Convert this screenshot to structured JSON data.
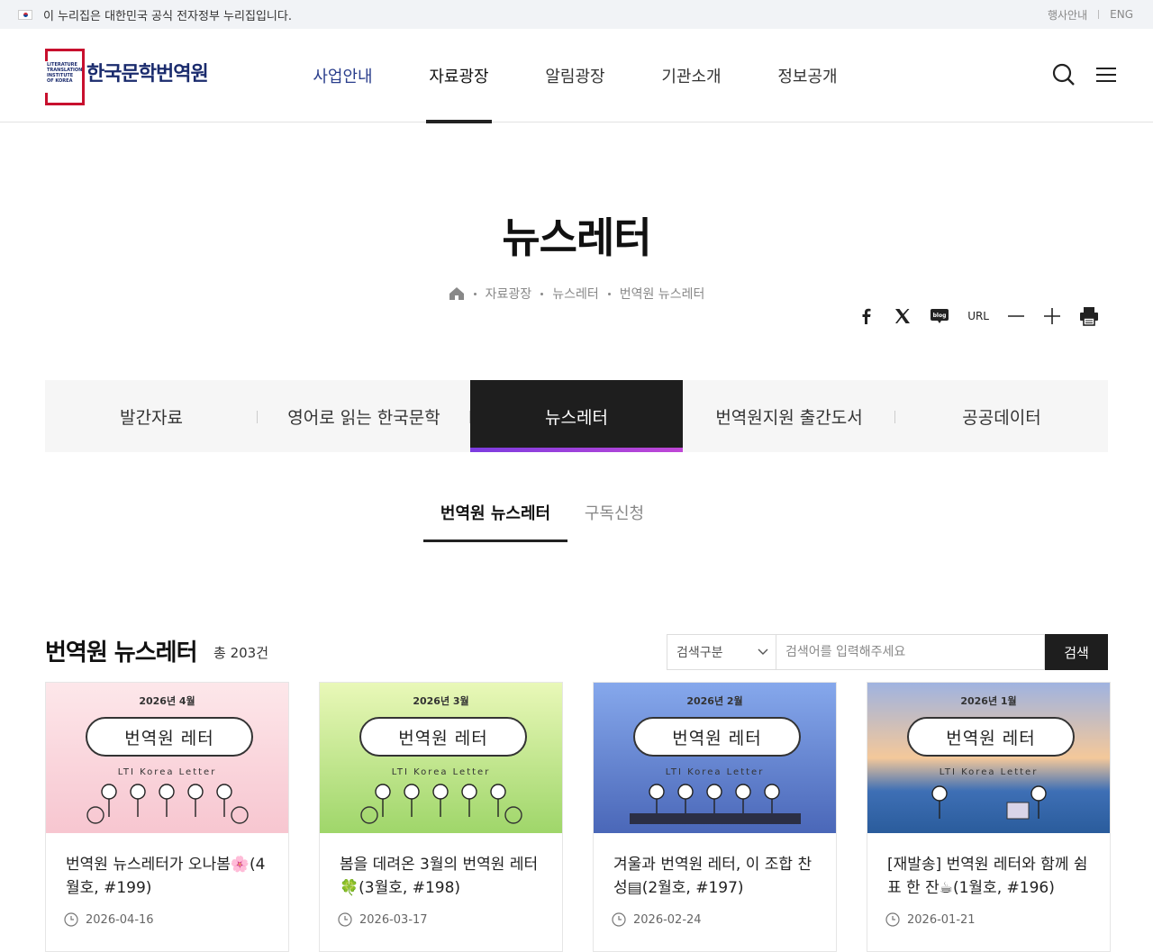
{
  "gov_banner": {
    "text": "이 누리집은 대한민국 공식 전자정부 누리집입니다.",
    "links": [
      "행사안내",
      "ENG"
    ]
  },
  "logo": {
    "name": "한국문학번역원",
    "mark_text": "LITERATURE TRANSLATION INSTITUTE OF KOREA"
  },
  "gnb": [
    "사업안내",
    "자료광장",
    "알림광장",
    "기관소개",
    "정보공개"
  ],
  "page_title": "뉴스레터",
  "breadcrumb": [
    "자료광장",
    "뉴스레터",
    "번역원 뉴스레터"
  ],
  "share": {
    "url_label": "URL"
  },
  "tabs": [
    "발간자료",
    "영어로 읽는 한국문학",
    "뉴스레터",
    "번역원지원 출간도서",
    "공공데이터"
  ],
  "subtabs": [
    "번역원 뉴스레터",
    "구독신청"
  ],
  "list": {
    "title": "번역원 뉴스레터",
    "count": "총 203건",
    "search_select": "검색구분",
    "search_placeholder": "검색어를 입력해주세요",
    "search_button": "검색"
  },
  "cards": [
    {
      "month": "2026년 4월",
      "banner": "번역원  레터",
      "sub": "LTI Korea Letter",
      "title": "번역원 뉴스레터가 오나봄🌸(4월호, #199)",
      "date": "2026-04-16",
      "bg": "#fbe3e6"
    },
    {
      "month": "2026년 3월",
      "banner": "번역원  레터",
      "sub": "LTI Korea Letter",
      "title": "봄을 데려온 3월의 번역원 레터🍀(3월호, #198)",
      "date": "2026-03-17",
      "bg": "#d6efa8"
    },
    {
      "month": "2026년 2월",
      "banner": "번역원  레터",
      "sub": "LTI Korea Letter",
      "title": "겨울과 번역원 레터, 이 조합 찬성▤(2월호, #197)",
      "date": "2026-02-24",
      "bg": "#7f9fe0"
    },
    {
      "month": "2026년 1월",
      "banner": "번역원  레터",
      "sub": "LTI Korea Letter",
      "title": "[재발송] 번역원 레터와 함께 쉼표 한 잔☕(1월호, #196)",
      "date": "2026-01-21",
      "bg": "#f3c89a"
    }
  ]
}
